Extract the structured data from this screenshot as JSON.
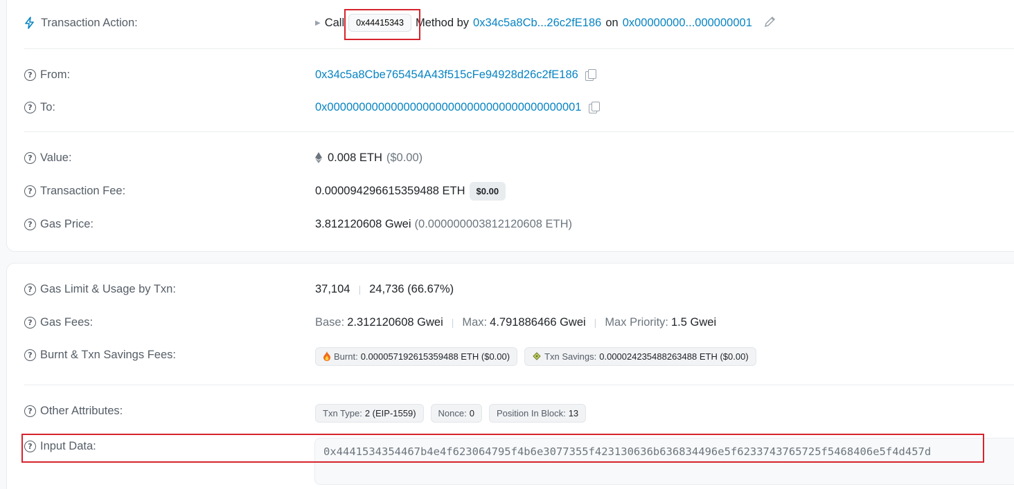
{
  "transaction_action": {
    "label": "Transaction Action:",
    "call": "Call",
    "method_id": "0x44415343",
    "method_by": "Method by",
    "from_short": "0x34c5a8Cb...26c2fE186",
    "on": "on",
    "to_short": "0x00000000...000000001"
  },
  "from": {
    "label": "From:",
    "address": "0x34c5a8Cbe765454A43f515cFe94928d26c2fE186"
  },
  "to": {
    "label": "To:",
    "address": "0x0000000000000000000000000000000000000001"
  },
  "value": {
    "label": "Value:",
    "amount": "0.008 ETH",
    "usd": "($0.00)"
  },
  "txn_fee": {
    "label": "Transaction Fee:",
    "amount": "0.000094296615359488 ETH",
    "usd_badge": "$0.00"
  },
  "gas_price": {
    "label": "Gas Price:",
    "gwei": "3.812120608 Gwei",
    "eth": "(0.000000003812120608 ETH)"
  },
  "gas_limit": {
    "label": "Gas Limit & Usage by Txn:",
    "limit": "37,104",
    "sep": "|",
    "usage": "24,736 (66.67%)"
  },
  "gas_fees": {
    "label": "Gas Fees:",
    "base_label": "Base:",
    "base": "2.312120608 Gwei",
    "max_label": "Max:",
    "max": "4.791886466 Gwei",
    "priority_label": "Max Priority:",
    "priority": "1.5 Gwei"
  },
  "burnt": {
    "label": "Burnt & Txn Savings Fees:",
    "burnt_label": "Burnt:",
    "burnt_value": "0.000057192615359488 ETH ($0.00)",
    "savings_label": "Txn Savings:",
    "savings_value": "0.000024235488263488 ETH ($0.00)"
  },
  "other": {
    "label": "Other Attributes:",
    "txn_type_label": "Txn Type:",
    "txn_type": "2 (EIP-1559)",
    "nonce_label": "Nonce:",
    "nonce": "0",
    "position_label": "Position In Block:",
    "position": "13"
  },
  "input_data": {
    "label": "Input Data:",
    "value": "0x4441534354467b4e4f623064795f4b6e3077355f423130636b636834496e5f6233743765725f5468406e5f4d457d"
  },
  "colors": {
    "link": "#0784c3",
    "highlight": "#d6232c"
  }
}
